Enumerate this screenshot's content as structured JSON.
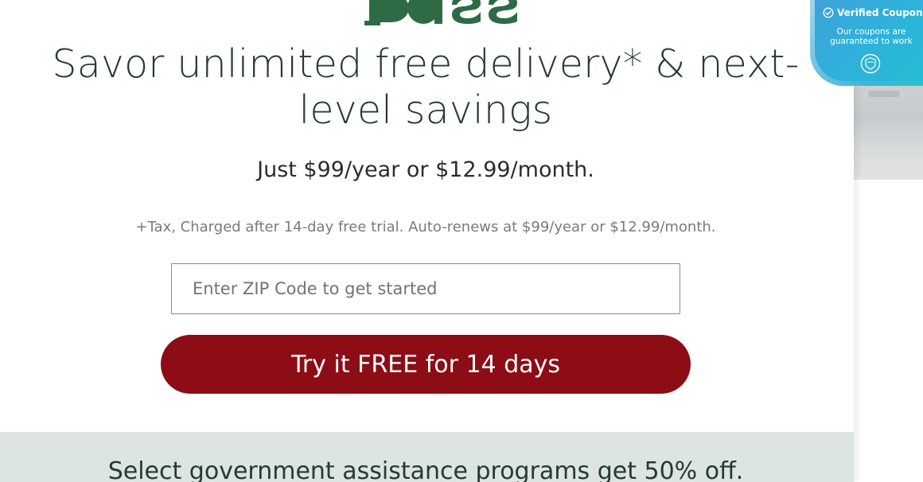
{
  "modal": {
    "headline": "Savor unlimited free delivery* & next-level savings",
    "price_line": "Just $99/year or $12.99/month.",
    "fine_print": "+Tax, Charged after 14-day free trial. Auto-renews at $99/year or $12.99/month.",
    "zip": {
      "placeholder": "Enter ZIP Code to get started",
      "value": ""
    },
    "cta_label": "Try it FREE for 14 days",
    "assist_banner": "Select government assistance programs get 50% off."
  },
  "coupon_badge": {
    "title": "Verified Coupon",
    "subtitle": "Our coupons are guaranteed to work",
    "icons": [
      "check-circle-icon",
      "shield-seal-icon"
    ]
  },
  "colors": {
    "headline": "#253a33",
    "logo_green": "#2e6b45",
    "cta_background": "#8c0d16",
    "banner_background": "#dce5e0",
    "badge_gradient_start": "#3fa2d8",
    "badge_gradient_end": "#23bfd2"
  }
}
